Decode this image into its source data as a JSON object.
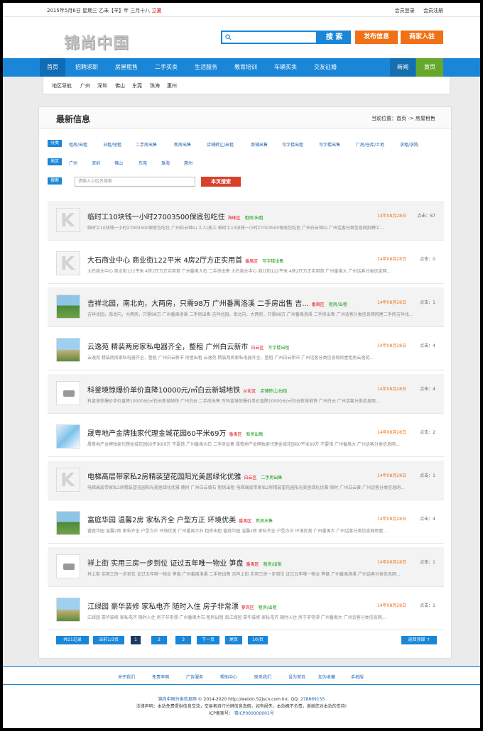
{
  "topbar": {
    "date": "2015年5月6日  星期三  乙未【羊】年 三月十八",
    "holiday": "立夏",
    "login": "会员登录",
    "register": "会员注册"
  },
  "header": {
    "logo": "锦尚中国",
    "search_placeholder": "",
    "search_button": "搜 索",
    "publish_button": "发布信息",
    "merchant_button": "商家入驻"
  },
  "nav": {
    "items": [
      "首页",
      "招聘求职",
      "房屋租售",
      "二手买卖",
      "生活服务",
      "教育培训",
      "车辆买卖",
      "交友征婚"
    ],
    "news": "新闻",
    "yellow": "黄页"
  },
  "regions": [
    "地区导航",
    "广州",
    "深圳",
    "佛山",
    "东莞",
    "珠海",
    "惠州"
  ],
  "main": {
    "title": "最新信息",
    "breadcrumb": "当前位置：首页 -> 房屋租售"
  },
  "filters": {
    "category_tag": "分类",
    "categories": [
      "租房/出租",
      "日租/短租",
      "二手房出售",
      "新房出售",
      "店铺转让/出租",
      "商铺出售",
      "写字楼出租",
      "写字楼出售",
      "厂房/仓库/土地",
      "求租/求购"
    ],
    "region_tag": "地区",
    "regions": [
      "广州",
      "深圳",
      "佛山",
      "东莞",
      "珠海",
      "惠州"
    ],
    "search_tag": "搜索",
    "keyword_placeholder": "请输入小区名搜索",
    "search_button": "本页搜索"
  },
  "listings": [
    {
      "title": "临时工10块钱一小时27003500保底包吃住",
      "area": "海珠区",
      "cat": "租房/出租",
      "date": "14年08月28日",
      "clicks": "点击：87",
      "desc": "临时工10块钱一小时27003500保底包吃住 广州白云钟山 工人/技工 临时工10块钱一小时27003500保底包吃住 广州白云钟山 广州话客分类信息网招聘工...",
      "thumb": "logo-k"
    },
    {
      "title": "大石商业中心  商业街122平米  4房2厅方正实用首",
      "area": "番禺区",
      "cat": "写字楼出售",
      "date": "14年08月28日",
      "clicks": "点击：0",
      "desc": "大石商业中心 商业街122平米 4房2厅方正实用首 广州番禺大石 二手房出售 大石商业中心 商业街122平米 4房2厅方正实用首 广州番禺大 广州话客分类信息网...",
      "thumb": "logo-k"
    },
    {
      "title": "吉祥北园，南北向，大两房，只需98万  广州番禺洛溪  二手房出售  吉...",
      "area": "番禺区",
      "cat": "租房/出租",
      "date": "14年08月28日",
      "clicks": "点击：1",
      "desc": "吉祥北园，南北向，大两房，只需98万 广州番禺洛溪 二手房出售 吉祥北园，南北向，大两房，只需98万 广州番禺洛溪 二手房出售 广州话客分类信息网房屋二手房吉祥北...",
      "thumb": "land"
    },
    {
      "title": "云逸苑  精装两房家私电器齐全，整租  广州白云新市",
      "area": "白云区",
      "cat": "写字楼出租",
      "date": "14年08月28日",
      "clicks": "点击：4",
      "desc": "云逸苑 精装两房家私电器齐全，整租 广州白云新市 房屋出租 云逸苑 精装两房家私电器齐全，整租 广州白云新市 广州话客分类信息网房屋租房云逸苑...",
      "thumb": "land2"
    },
    {
      "title": "科釜境惊爆价单价直降10000元/㎡白云新城地铁",
      "area": "从化区",
      "cat": "店铺转让/出租",
      "date": "14年08月28日",
      "clicks": "点击：4",
      "desc": "科釜境惊爆价单价直降10000元/㎡白云新城地铁 广州白云 二手房出售 万科釜境惊爆价单价直降10000元/㎡白云新城地铁 广州白云 广州话客分类信息网...",
      "thumb": "cam"
    },
    {
      "title": "晟粤地产金牌独家代理金城花园60平米69万",
      "area": "番禺区",
      "cat": "新房出售",
      "date": "14年08月28日",
      "clicks": "点击：2",
      "desc": "晟粤地产金牌独家代理金城花园60平米69万 不要错 广州番禺大石 二手房出售 晟粤地产金牌独家代理金城花园60平米69万 不要错 广州番禺大 广州话客分类信息网...",
      "thumb": "blue"
    },
    {
      "title": "电梯高层带家私2房精装望花园阳光美居绿化优雅",
      "area": "白云区",
      "cat": "二手房出售",
      "date": "14年08月28日",
      "clicks": "点击：1",
      "desc": "电梯高层带家私2房精装望花园阳光美居绿化优雅 随时 广州白云黄石 租房出租 电梯高层带家私2房精装望花园阳光美居绿化优雅 随时 广州白云黄 广州话客分类信息网...",
      "thumb": "logo-k"
    },
    {
      "title": "富庭华园  温馨2房  家私齐全  户型方正  环境优美",
      "area": "番禺区",
      "cat": "新房出售",
      "date": "14年08月28日",
      "clicks": "点击：4",
      "desc": "富庭华园 温馨2房 家私齐全 户型方正 环境优美 广州番禺大石 租房出租 富庭华园 温馨2房 家私齐全 户型方正 环境优美 广州番禺大 广州话客分类信息网房屋...",
      "thumb": "land"
    },
    {
      "title": "祥上街  实用三房一步到位  证过五年唯一物业  笋盘",
      "area": "番禺区",
      "cat": "租房/出租",
      "date": "14年08月28日",
      "clicks": "点击：1",
      "desc": "祥上街 实用三房一步到位 证过五年唯一物业 笋盘 广州番禺洛溪 二手房出售 吉祥上街 实用三房一步到位 证过五年唯一物业 笋盘 广州番禺洛溪 广州话客分类信息网...",
      "thumb": "cam"
    },
    {
      "title": "江绿园  豪华装修  家私电齐  随时入住  房子非常漂",
      "area": "萝岗区",
      "cat": "租房/出租",
      "date": "14年08月28日",
      "clicks": "点击：1",
      "desc": "江绿园 豪华装修 家私电齐 随时入住 房子非常漂 广州番禺大石 租房出租 南江绿园 豪华装修 家私电齐 随时入住 房子非常漂 广州番禺大 广州话客分类信息网...",
      "thumb": "land2"
    }
  ],
  "pager": {
    "total": "共21记录",
    "current": "当前1/3页",
    "pages": [
      "1",
      "2",
      "3"
    ],
    "next": "下一页",
    "last": "尾页",
    "per": "10/页",
    "top": "返回顶部 ↑"
  },
  "footer_links": [
    "关于我们",
    "免责申明",
    "广告服务",
    "帮助中心",
    "联系我们",
    "设为首页",
    "加为收藏",
    "手机版"
  ],
  "footer": {
    "site": "锦尚中国分类信息网",
    "copyright": "© 2014-2020  http://weixin.52jscn.com Inc.  QQ:",
    "qq": "278869155",
    "notice": "法律声明：本站免费提供信息交流，交易者自行分辨信息真假，如有损失，本站概不负责。谢谢您对本站的支持!",
    "icp_label": "ICP备案号：",
    "icp": "粤ICP000000001号"
  }
}
